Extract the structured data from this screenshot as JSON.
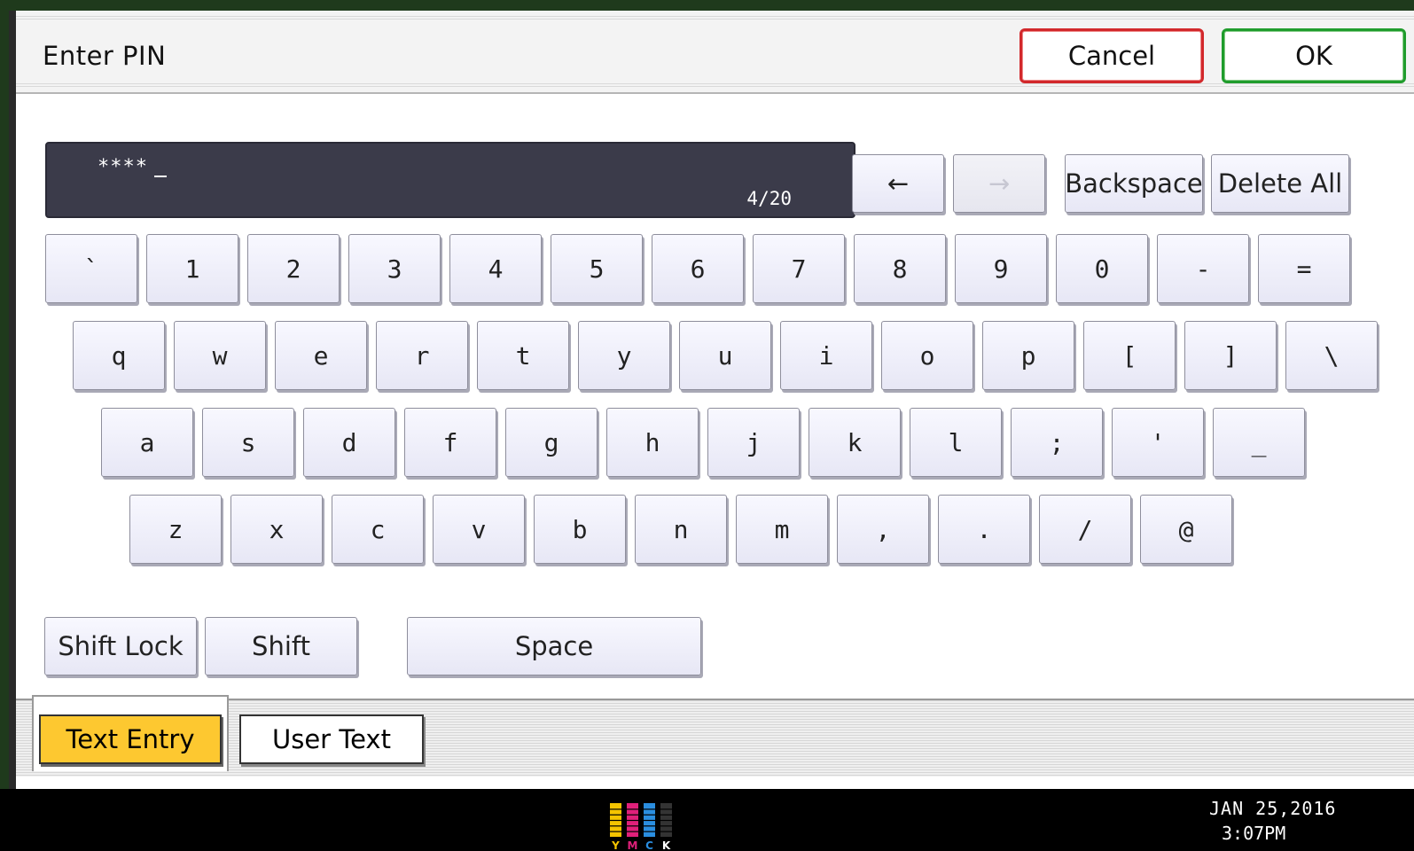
{
  "dialog": {
    "title": "Enter PIN",
    "cancel_label": "Cancel",
    "ok_label": "OK"
  },
  "input": {
    "masked_value": "****",
    "counter": "4/20"
  },
  "edit_buttons": {
    "left_arrow": "←",
    "right_arrow": "→",
    "backspace": "Backspace",
    "delete_all": "Delete All"
  },
  "keyboard": {
    "row1": [
      "`",
      "1",
      "2",
      "3",
      "4",
      "5",
      "6",
      "7",
      "8",
      "9",
      "0",
      "-",
      "="
    ],
    "row2": [
      "q",
      "w",
      "e",
      "r",
      "t",
      "y",
      "u",
      "i",
      "o",
      "p",
      "[",
      "]",
      "\\"
    ],
    "row3": [
      "a",
      "s",
      "d",
      "f",
      "g",
      "h",
      "j",
      "k",
      "l",
      ";",
      "'",
      "_"
    ],
    "row4": [
      "z",
      "x",
      "c",
      "v",
      "b",
      "n",
      "m",
      ",",
      ".",
      "/",
      "@"
    ]
  },
  "modifiers": {
    "shift_lock": "Shift Lock",
    "shift": "Shift",
    "space": "Space"
  },
  "tabs": [
    {
      "label": "Text Entry",
      "active": true
    },
    {
      "label": "User Text",
      "active": false
    }
  ],
  "status": {
    "toner_labels": [
      "Y",
      "M",
      "C",
      "K"
    ],
    "toner_colors": [
      "#f5c400",
      "#e0207a",
      "#2a8ee0",
      "#333333"
    ],
    "date": "JAN  25,2016",
    "time": "3:07PM"
  }
}
